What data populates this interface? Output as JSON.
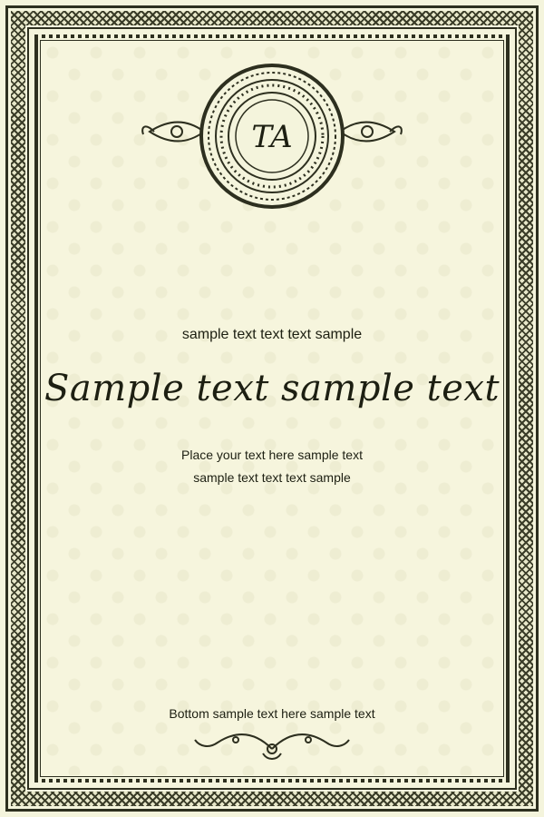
{
  "emblem": {
    "monogram": "TA"
  },
  "heading_small": "sample text text text sample",
  "heading_script": "Sample text sample text",
  "body": {
    "line1": "Place your text here sample text",
    "line2": "sample text text text sample"
  },
  "footer": "Bottom sample text here sample text",
  "colors": {
    "ink": "#2d2f1f",
    "paper": "#f4f4dc"
  }
}
